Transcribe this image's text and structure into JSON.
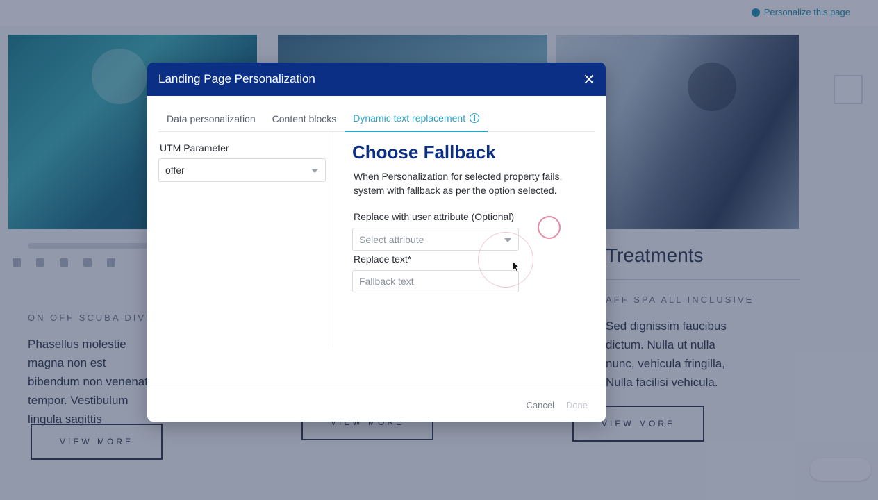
{
  "background": {
    "top_link": "Personalize this page",
    "heading": "Treatments",
    "subheading": "AFF SPA ALL INCLUSIVE",
    "left_subheading": "ON OFF SCUBA DIVING",
    "left_text": "Phasellus molestie magna non est bibendum non venenatis tempor. Vestibulum lingula sagittis",
    "right_text": "Sed dignissim faucibus dictum. Nulla ut nulla nunc, vehicula fringilla, Nulla facilisi vehicula.",
    "view_more": "VIEW MORE"
  },
  "modal": {
    "title": "Landing Page Personalization",
    "tabs": [
      {
        "label": "Data personalization"
      },
      {
        "label": "Content blocks"
      },
      {
        "label": "Dynamic text replacement"
      }
    ],
    "utm": {
      "label": "UTM Parameter",
      "value": "offer"
    },
    "fallback": {
      "title": "Choose Fallback",
      "description": "When Personalization for selected property fails, system with fallback as per the option selected.",
      "attribute_label": "Replace with user attribute (Optional)",
      "attribute_placeholder": "Select attribute",
      "replace_label": "Replace text*",
      "replace_placeholder": "Fallback text"
    },
    "footer": {
      "cancel": "Cancel",
      "done": "Done"
    }
  },
  "colors": {
    "header_bg": "#0a2f85",
    "accent": "#2aa5c6",
    "title": "#0a2f85"
  }
}
